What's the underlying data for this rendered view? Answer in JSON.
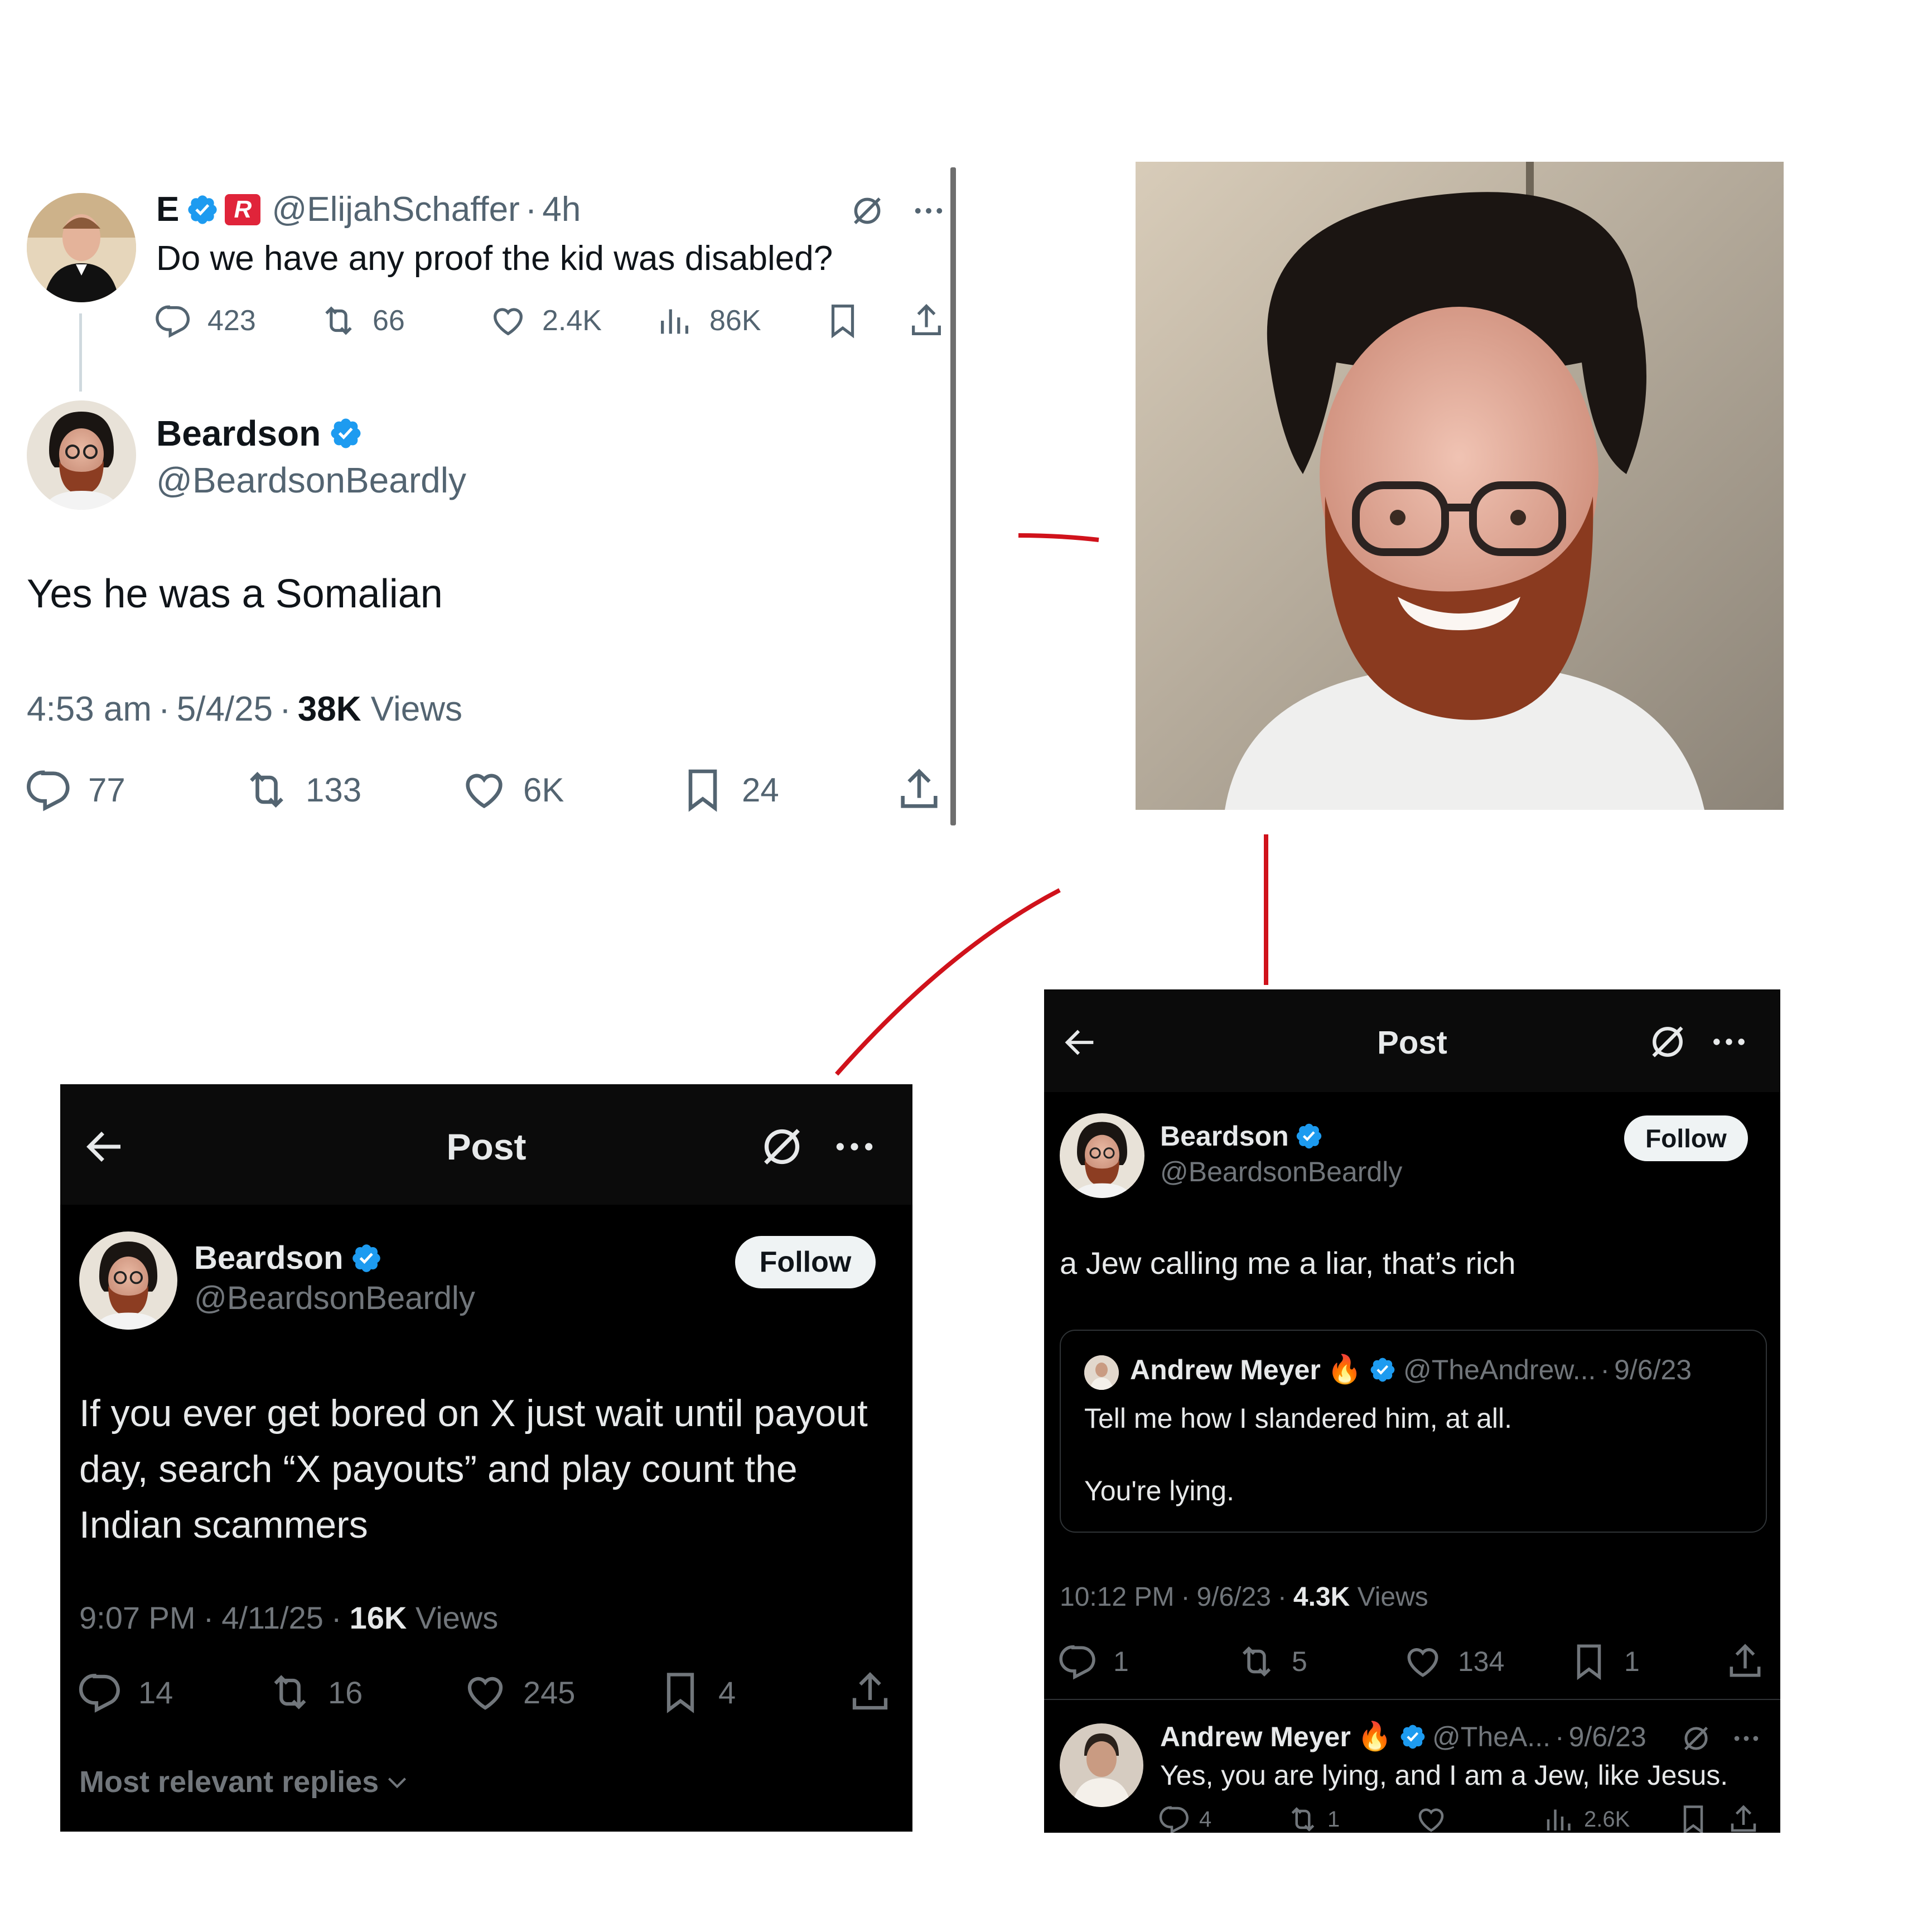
{
  "colors": {
    "accent": "#1d9bf0",
    "annotation": "#d0121b",
    "dark_bg": "#000000"
  },
  "panel_top": {
    "orig": {
      "name": "E",
      "handle": "@ElijahSchaffer",
      "time": "4h",
      "sep": "·",
      "text": "Do we have any proof the kid was disabled?",
      "replies": "423",
      "reposts": "66",
      "likes": "2.4K",
      "views": "86K"
    },
    "reply": {
      "name": "Beardson",
      "handle": "@BeardsonBeardly",
      "text": "Yes he was a Somalian",
      "time": "4:53 am",
      "date": "5/4/25",
      "views_count": "38K",
      "views_label": "Views",
      "sep": "·",
      "replies": "77",
      "reposts": "133",
      "likes": "6K",
      "bookmarks": "24"
    }
  },
  "panel_left": {
    "title": "Post",
    "name": "Beardson",
    "handle": "@BeardsonBeardly",
    "follow": "Follow",
    "text": "If you ever get bored on X just wait until payout day, search “X payouts” and play count the Indian scammers",
    "time": "9:07 PM",
    "date": "4/11/25",
    "views_count": "16K",
    "views_label": "Views",
    "sep": "·",
    "replies": "14",
    "reposts": "16",
    "likes": "245",
    "bookmarks": "4",
    "footer": "Most relevant replies"
  },
  "panel_right": {
    "title": "Post",
    "name": "Beardson",
    "handle": "@BeardsonBeardly",
    "follow": "Follow",
    "text": "a Jew calling me a liar, that’s rich",
    "quote": {
      "name": "Andrew Meyer",
      "emoji": "🔥",
      "handle": "@TheAndrew...",
      "date": "9/6/23",
      "sep": "·",
      "line1": "Tell me how I slandered him, at all.",
      "line2": "You're lying."
    },
    "time": "10:12 PM",
    "date": "9/6/23",
    "views_count": "4.3K",
    "views_label": "Views",
    "sep": "·",
    "replies": "1",
    "reposts": "5",
    "likes": "134",
    "bookmarks": "1",
    "reply": {
      "name": "Andrew Meyer",
      "emoji": "🔥",
      "handle": "@TheA...",
      "date": "9/6/23",
      "sep": "·",
      "text": "Yes, you are lying, and I am a Jew, like Jesus.",
      "replies": "4",
      "reposts": "1",
      "views": "2.6K"
    }
  },
  "icons": [
    "verified-badge",
    "brand-badge",
    "grok-icon",
    "more-icon",
    "reply-icon",
    "repost-icon",
    "like-icon",
    "views-icon",
    "bookmark-icon",
    "share-icon",
    "back-arrow-icon",
    "chevron-down-icon"
  ]
}
